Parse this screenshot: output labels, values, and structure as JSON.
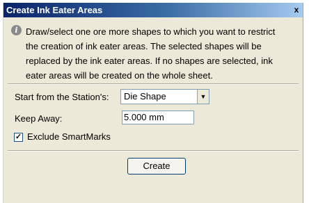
{
  "window": {
    "title": "Create Ink Eater Areas",
    "close_glyph": "x"
  },
  "info": {
    "icon": "info-icon",
    "lines": [
      "Draw/select one ore more shapes to which you want to restrict",
      "the creation of ink eater areas. The selected shapes will be",
      "replaced by the ink eater areas. If no shapes are selected, ink",
      "eater areas will be created on the whole sheet."
    ]
  },
  "form": {
    "start_label": "Start from the Station's:",
    "start_value": "Die Shape",
    "keep_away_label": "Keep Away:",
    "keep_away_value": "5.000 mm",
    "exclude_label": "Exclude SmartMarks",
    "exclude_checked": true
  },
  "actions": {
    "create_label": "Create"
  }
}
